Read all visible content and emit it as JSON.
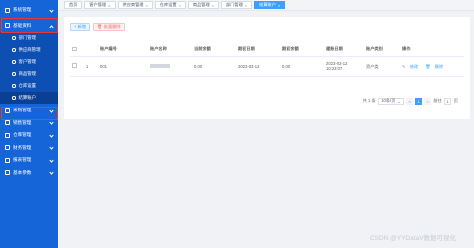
{
  "sidebar": {
    "groups_top": [
      {
        "label": "系统管理",
        "icon": "computer-icon"
      },
      {
        "label": "基础资料",
        "icon": "folder-icon",
        "open": true
      }
    ],
    "subitems": [
      {
        "label": "部门管理",
        "icon": "user-icon"
      },
      {
        "label": "供应商管理",
        "icon": "user-icon"
      },
      {
        "label": "客户管理",
        "icon": "user-icon"
      },
      {
        "label": "商品管理",
        "icon": "user-icon"
      },
      {
        "label": "仓库设置",
        "icon": "user-icon"
      },
      {
        "label": "结算账户",
        "icon": "user-icon",
        "active": true
      }
    ],
    "groups_bottom": [
      {
        "label": "采购管理",
        "icon": "cart-icon"
      },
      {
        "label": "销售管理",
        "icon": "cart-icon"
      },
      {
        "label": "仓库管理",
        "icon": "home-icon"
      },
      {
        "label": "财务管理",
        "icon": "money-icon"
      },
      {
        "label": "报表管理",
        "icon": "chart-icon"
      },
      {
        "label": "基本参数",
        "icon": "settings-icon"
      }
    ]
  },
  "tabs": [
    {
      "label": "首页",
      "closable": false
    },
    {
      "label": "客户管理",
      "closable": true
    },
    {
      "label": "供应商管理",
      "closable": true
    },
    {
      "label": "仓库设置",
      "closable": true
    },
    {
      "label": "商品管理",
      "closable": true
    },
    {
      "label": "部门管理",
      "closable": true
    },
    {
      "label": "结算账户",
      "closable": true,
      "active": true
    }
  ],
  "toolbar": {
    "add_label": "+ 新增",
    "batch_delete_label": "批量删除"
  },
  "table": {
    "columns": [
      "",
      "",
      "账户编号",
      "账户名称",
      "当前余额",
      "期初日期",
      "期初余额",
      "建账日期",
      "账户类别",
      "操作"
    ],
    "rows": [
      {
        "index": "1",
        "account_no": "001",
        "current_balance": "0.00",
        "opening_date": "2023-03-12",
        "opening_balance": "0.00",
        "created_date": "2023-03-12 10:23:07",
        "category": "资产类",
        "edit_label": "修改",
        "delete_label": "删除"
      }
    ]
  },
  "pager": {
    "total_text": "共 1 条",
    "page_size": "10条/页",
    "prev": "<",
    "current_page": "1",
    "next": ">",
    "goto_prefix": "前往",
    "goto_value": "1",
    "goto_suffix": "页"
  },
  "watermark": "CSDN @YYDataV数据可视化",
  "colors": {
    "sidebar_bg": "#1565d8",
    "accent": "#409eff",
    "highlight_border": "#e53935"
  }
}
